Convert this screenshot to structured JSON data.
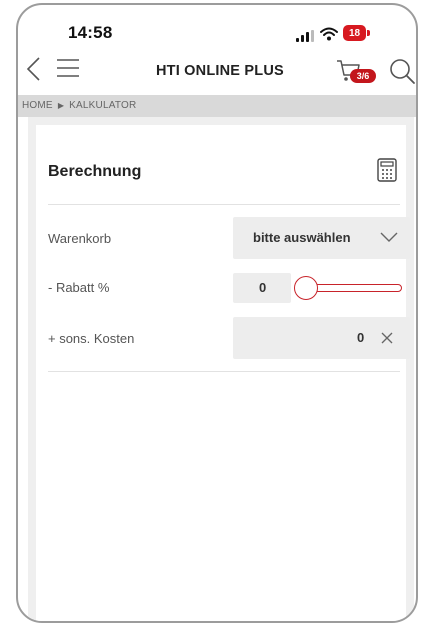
{
  "status_bar": {
    "time": "14:58",
    "battery_level": "18"
  },
  "header": {
    "title": "HTI ONLINE PLUS",
    "cart_badge": "3/6"
  },
  "breadcrumb": {
    "items": [
      "HOME",
      "KALKULATOR"
    ]
  },
  "card": {
    "title": "Berechnung",
    "rows": [
      {
        "label": "Warenkorb",
        "control": "select",
        "value": "bitte auswählen"
      },
      {
        "label": "- Rabatt %",
        "control": "slider",
        "value": "0"
      },
      {
        "label": "+ sons. Kosten",
        "control": "input",
        "value": "0"
      }
    ]
  },
  "colors": {
    "accent": "#c8232a",
    "badge": "#c3161c",
    "breadcrumb_bg": "#d9d9d9",
    "field_bg": "#ededed"
  },
  "icons": [
    "back-icon",
    "menu-icon",
    "cart-icon",
    "search-icon",
    "calculator-icon",
    "chevron-down-icon",
    "clear-icon"
  ]
}
